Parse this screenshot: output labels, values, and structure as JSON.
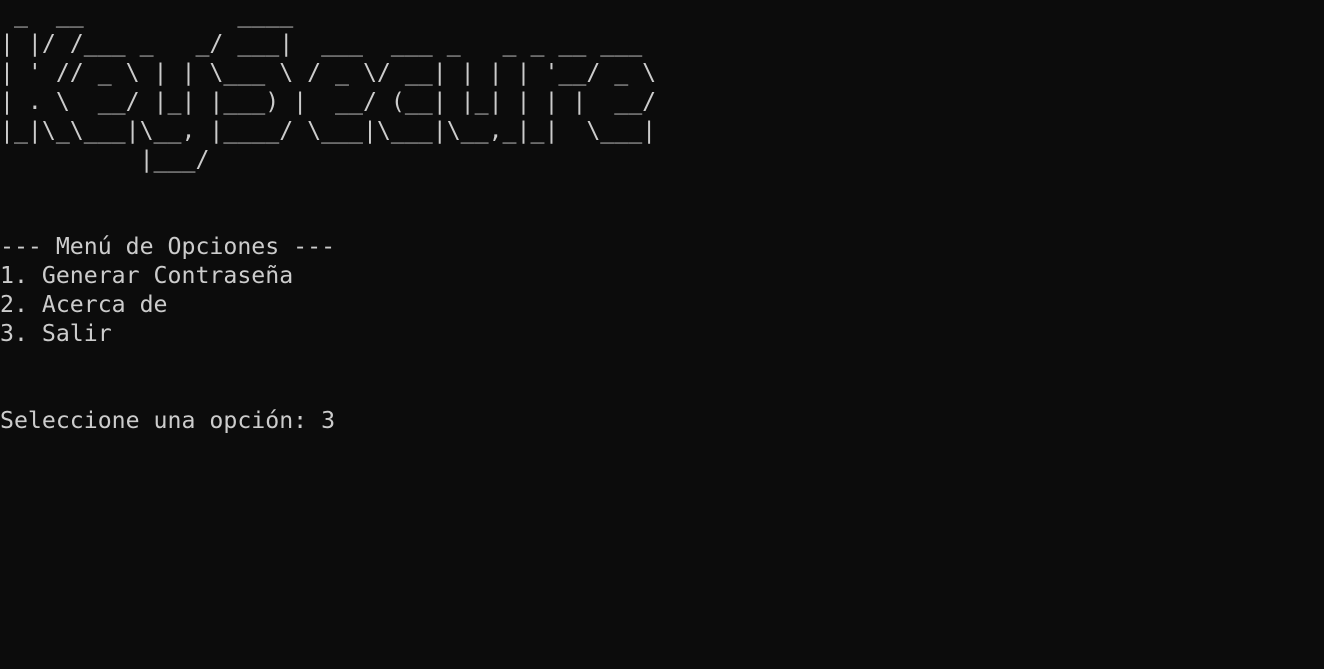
{
  "banner": {
    "lines": [
      " _  __           ____",
      "| |/ /___ _   _/ ___|  ___  ___ _   _ _ __ ___",
      "| ' // _ \\ | | \\___ \\ / _ \\/ __| | | | '__/ _ \\",
      "| . \\  __/ |_| |___) |  __/ (__| |_| | | |  __/",
      "|_|\\_\\___|\\__, |____/ \\___|\\___|\\__,_|_|  \\___|",
      "          |___/"
    ]
  },
  "menu": {
    "title": "--- Menú de Opciones ---",
    "options": [
      "1. Generar Contraseña",
      "2. Acerca de",
      "3. Salir"
    ]
  },
  "prompt": {
    "label": "Seleccione una opción: ",
    "input": "3"
  }
}
